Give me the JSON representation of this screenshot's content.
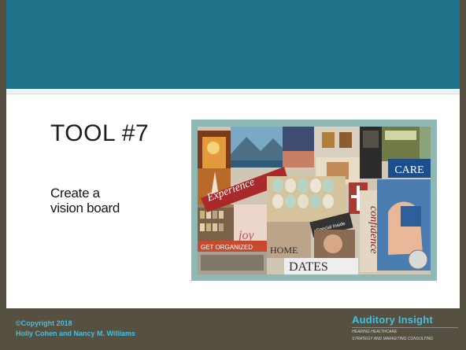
{
  "slide": {
    "title": "TOOL #7",
    "body_line1": "Create a",
    "body_line2": "vision board"
  },
  "collage": {
    "words": [
      "Experience",
      "CARE",
      "joy",
      "HOME",
      "DATES",
      "confidence",
      "GET ORGANIZED",
      "Special Inside"
    ]
  },
  "footer": {
    "copyright_line1": "©Copyright 2018",
    "copyright_line2": "Holly Cohen and Nancy M. Williams",
    "brand_name": "Auditory Insight",
    "brand_tag_line1": "HEARING HEALTHCARE",
    "brand_tag_line2": "STRATEGY AND MARKETING CONSULTING"
  },
  "colors": {
    "banner": "#1f7287",
    "frame": "#55503f",
    "footer_text": "#46bfdf",
    "collage_background": "#8fb8b4"
  }
}
